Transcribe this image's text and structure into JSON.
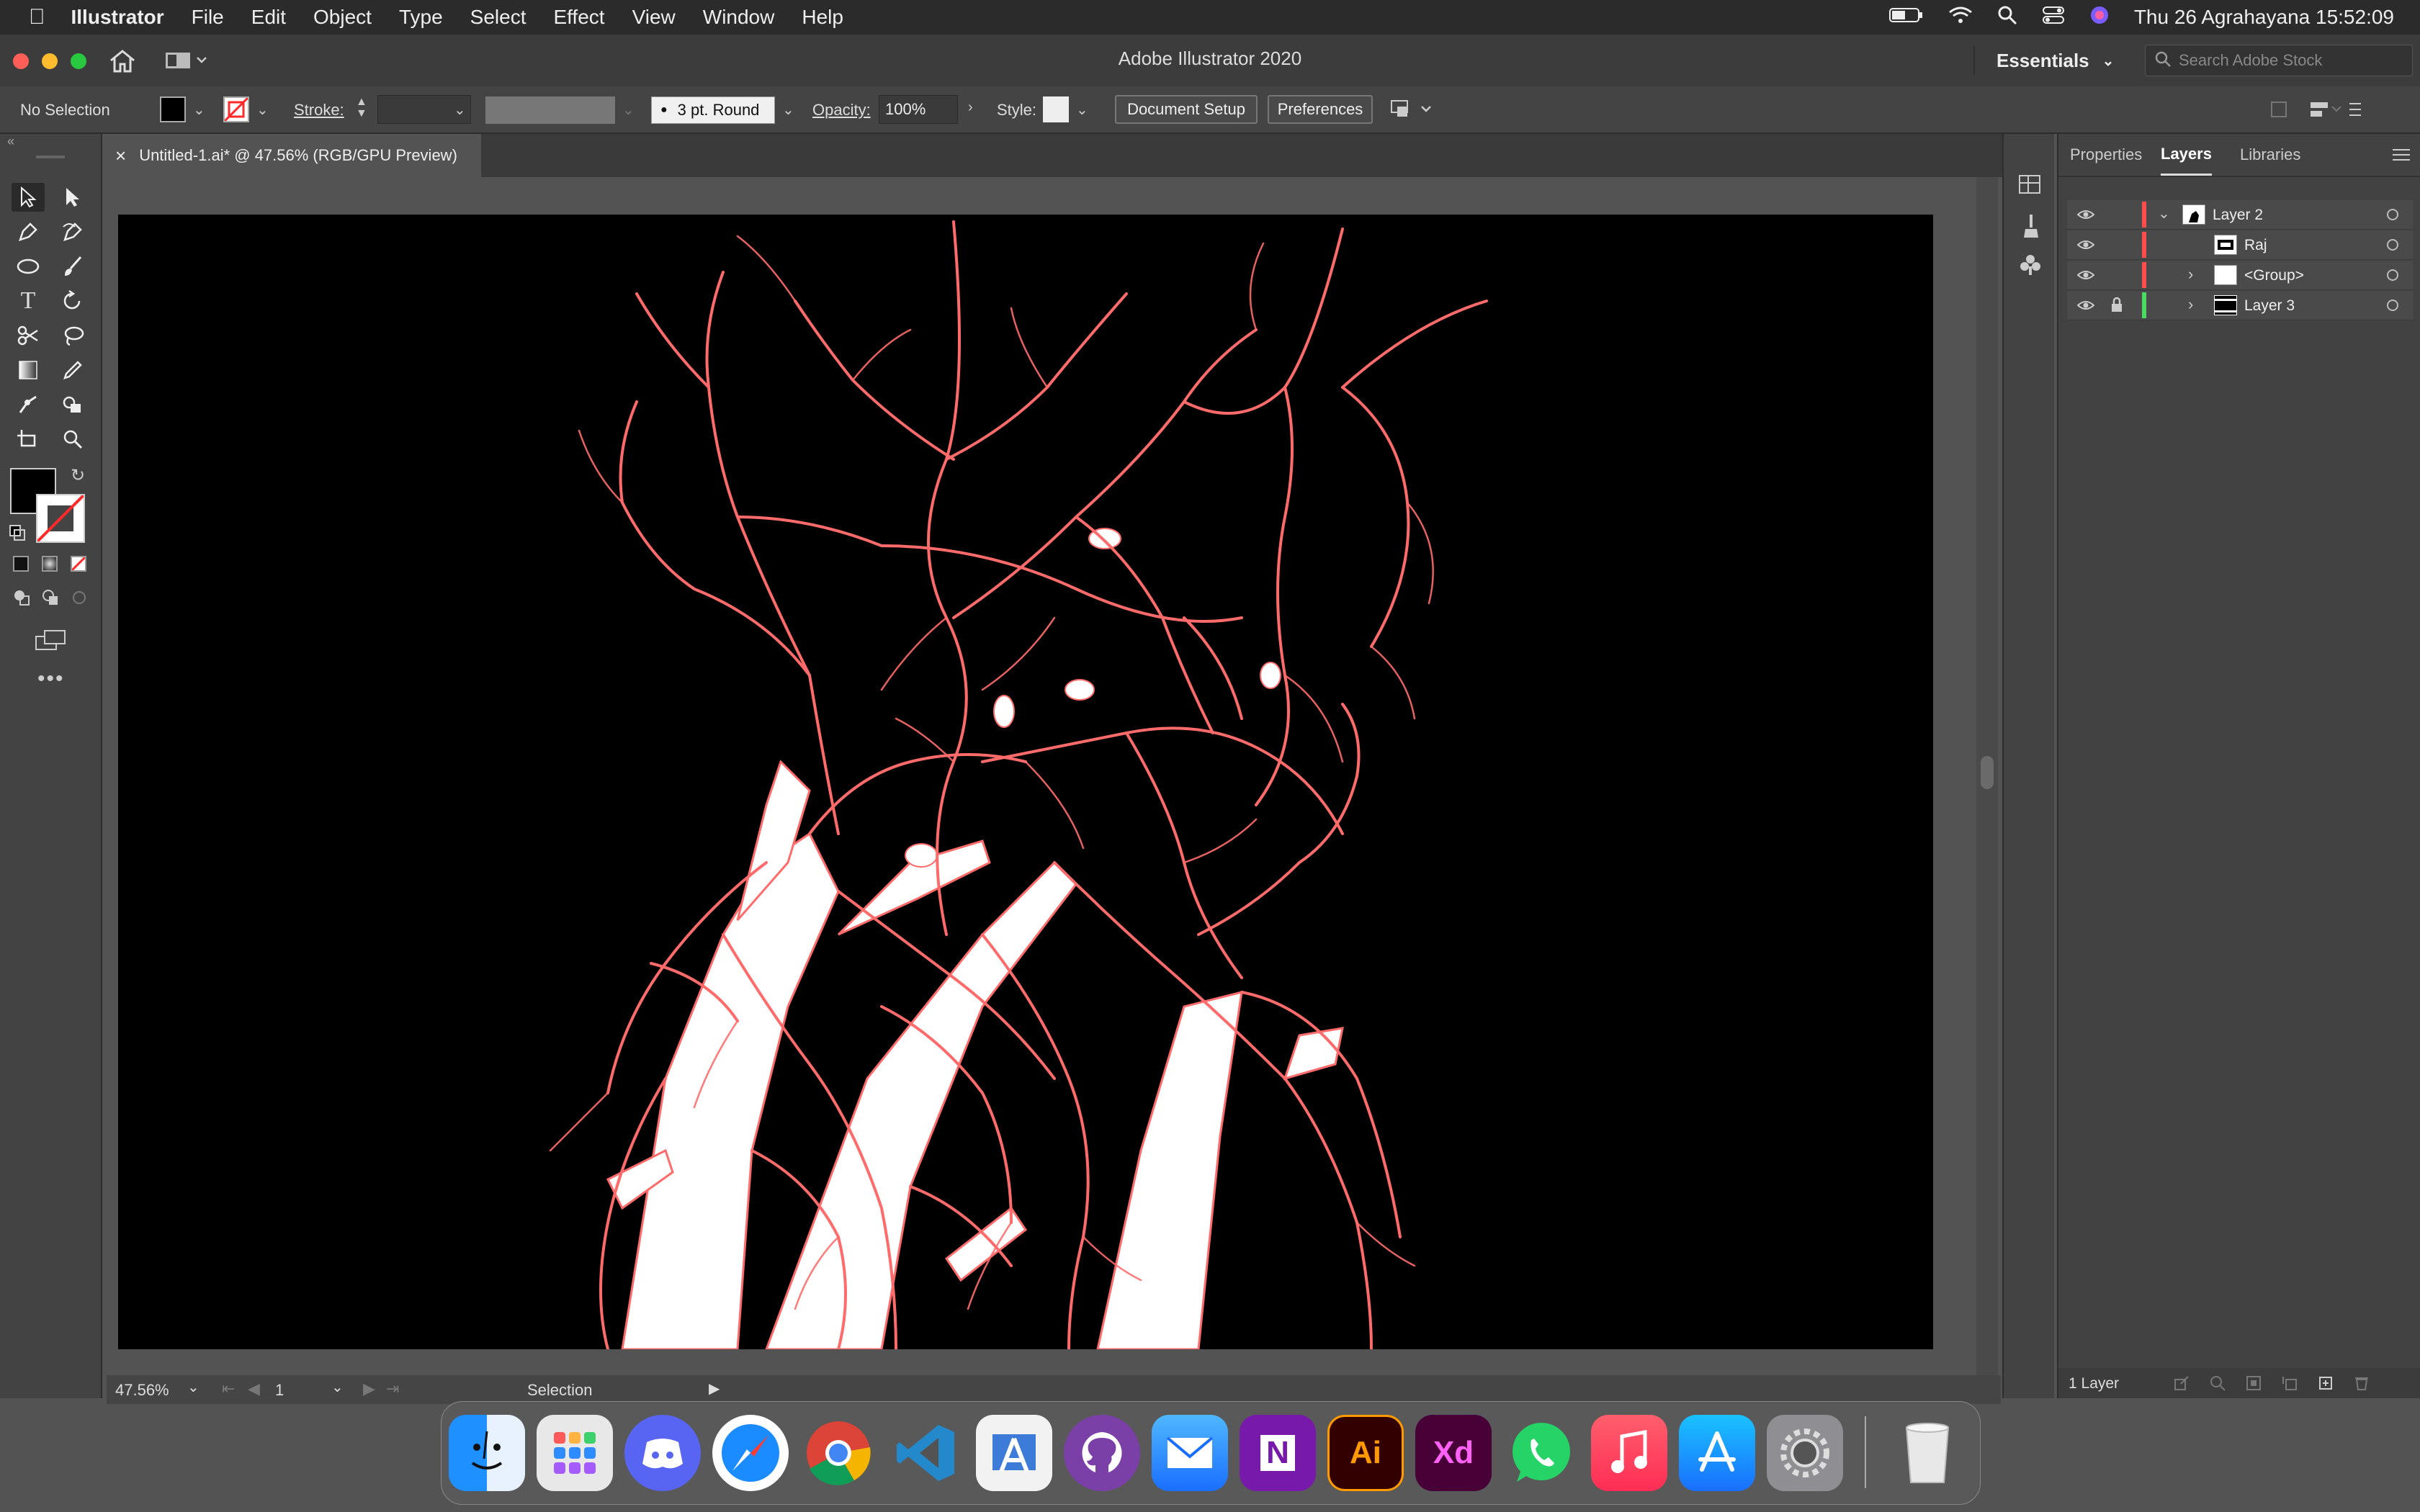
{
  "menubar": {
    "apple": "",
    "app_name": "Illustrator",
    "menus": [
      "File",
      "Edit",
      "Object",
      "Type",
      "Select",
      "Effect",
      "View",
      "Window",
      "Help"
    ],
    "clock": "Thu 26 Agrahayana  15:52:09"
  },
  "appbar": {
    "title": "Adobe Illustrator 2020",
    "workspace": "Essentials",
    "search_placeholder": "Search Adobe Stock"
  },
  "control": {
    "selection": "No Selection",
    "stroke_label": "Stroke:",
    "brush": "3 pt. Round",
    "opacity_label": "Opacity:",
    "opacity_value": "100%",
    "style_label": "Style:",
    "document_setup": "Document Setup",
    "preferences": "Preferences"
  },
  "document": {
    "tab_title": "Untitled-1.ai* @ 47.56% (RGB/GPU Preview)",
    "close": "×"
  },
  "status": {
    "zoom": "47.56%",
    "artboard": "1",
    "tool": "Selection"
  },
  "panel": {
    "tabs": [
      "Properties",
      "Layers",
      "Libraries"
    ],
    "active_tab": "Layers",
    "layers": [
      {
        "name": "Layer 2",
        "color": "#ff4d4d",
        "expanded": true
      },
      {
        "name": "Raj",
        "color": "#ff4d4d"
      },
      {
        "name": "<Group>",
        "color": "#ff4d4d"
      },
      {
        "name": "Layer 3",
        "color": "#4cd964",
        "locked": true
      }
    ],
    "footer": "1 Layer"
  },
  "dock": {
    "apps": [
      "Finder",
      "Launchpad",
      "Discord",
      "Safari",
      "Chrome",
      "VS Code",
      "Android Studio",
      "GitHub Desktop",
      "Mail",
      "OneNote",
      "Ai",
      "Xd",
      "WhatsApp",
      "Music",
      "App Store",
      "System Preferences",
      "Trash"
    ]
  },
  "colors": {
    "artwork_stroke": "#ff6b6b",
    "artwork_fill": "#ffffff",
    "artboard": "#000000"
  }
}
